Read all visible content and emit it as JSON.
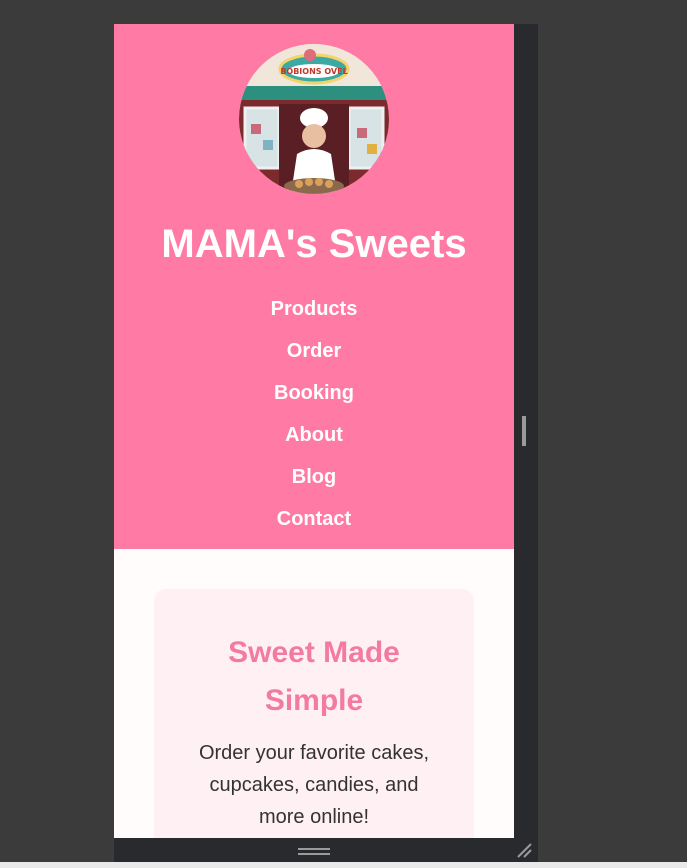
{
  "site": {
    "title": "MAMA's Sweets",
    "logo_sign_text": "BOBIONS OVEL",
    "logo_icon": "bakery-storefront-baker-photo"
  },
  "nav": {
    "items": [
      {
        "label": "Products"
      },
      {
        "label": "Order"
      },
      {
        "label": "Booking"
      },
      {
        "label": "About"
      },
      {
        "label": "Blog"
      },
      {
        "label": "Contact"
      }
    ]
  },
  "hero": {
    "title": "Sweet Made Simple",
    "text": "Order your favorite cakes, cupcakes, candies, and more online!"
  },
  "colors": {
    "header_bg": "#ff7ba5",
    "hero_card_bg": "#fff0f4",
    "hero_title": "#f27aa3",
    "page_bg": "#fffcfb",
    "devtools_bg": "#3b3b3b"
  }
}
